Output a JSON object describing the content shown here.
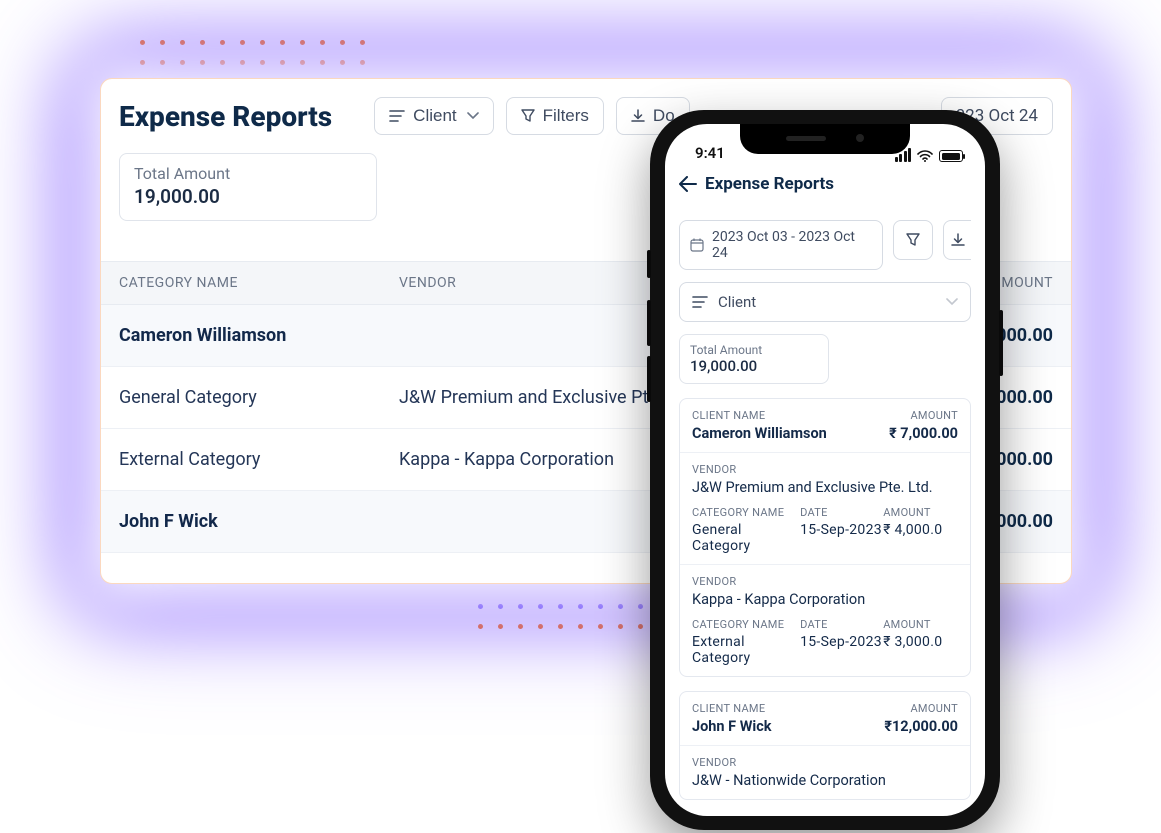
{
  "desktop": {
    "title": "Expense Reports",
    "group_by_label": "Client",
    "filters_label": "Filters",
    "download_label": "Do",
    "date_range": "023 Oct 24",
    "total_amount_label": "Total Amount",
    "total_amount_value": "19,000.00",
    "columns": {
      "category": "CATEGORY NAME",
      "vendor": "VENDOR",
      "amount": "MOUNT"
    },
    "rows": [
      {
        "type": "group",
        "name": "Cameron Williamson",
        "vendor": "",
        "amount": "000.00"
      },
      {
        "type": "row",
        "name": "General Category",
        "vendor": "J&W Premium and Exclusive Pte.",
        "amount": "000.00"
      },
      {
        "type": "row",
        "name": "External Category",
        "vendor": "Kappa - Kappa Corporation",
        "amount": "000.00"
      },
      {
        "type": "group",
        "name": "John F Wick",
        "vendor": "",
        "amount": "000.00"
      }
    ]
  },
  "phone": {
    "status_time": "9:41",
    "title": "Expense Reports",
    "date_range": "2023 Oct 03 - 2023 Oct 24",
    "group_by_label": "Client",
    "total_amount_label": "Total Amount",
    "total_amount_value": "19,000.00",
    "labels": {
      "client_name": "CLIENT NAME",
      "amount": "AMOUNT",
      "vendor": "VENDOR",
      "category_name": "CATEGORY NAME",
      "date": "DATE"
    },
    "groups": [
      {
        "client_name": "Cameron Williamson",
        "amount": "₹ 7,000.00",
        "items": [
          {
            "vendor": "J&W Premium and Exclusive Pte. Ltd.",
            "category": "General Category",
            "date": "15-Sep-2023",
            "amount": "₹ 4,000.0"
          },
          {
            "vendor": "Kappa - Kappa Corporation",
            "category": "External Category",
            "date": "15-Sep-2023",
            "amount": "₹ 3,000.0"
          }
        ]
      },
      {
        "client_name": "John F Wick",
        "amount": "₹12,000.00",
        "items": [
          {
            "vendor": "J&W - Nationwide Corporation",
            "category": "",
            "date": "",
            "amount": ""
          }
        ]
      }
    ]
  }
}
